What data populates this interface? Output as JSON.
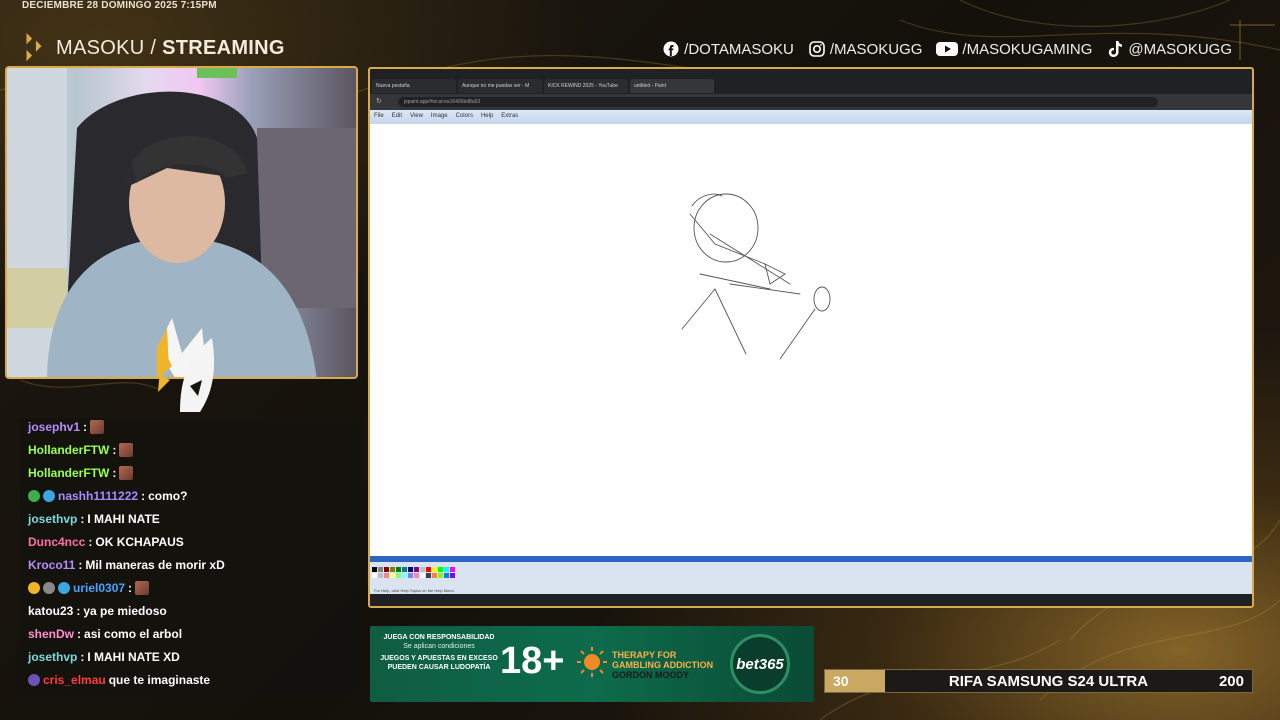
{
  "overlay": {
    "datetime": "DECIEMBRE 28 DOMINGO 2025 7:15PM",
    "brand_name": "MASOKU",
    "brand_separator": " / ",
    "brand_tag": "STREAMING",
    "accent_color": "#d8aa4a"
  },
  "socials": [
    {
      "icon": "facebook-icon",
      "label": "/DOTAMASOKU"
    },
    {
      "icon": "instagram-icon",
      "label": "/MASOKUGG"
    },
    {
      "icon": "youtube-icon",
      "label": "/MASOKUGAMING"
    },
    {
      "icon": "tiktok-icon",
      "label": "@MASOKUGG"
    }
  ],
  "browser": {
    "tabs": [
      {
        "label": "Nueva pestaña"
      },
      {
        "label": "Aunque no me puedas ver - M"
      },
      {
        "label": "KICK REWIND 2025 - YouTube"
      },
      {
        "label": "untitled - Paint"
      }
    ],
    "url": "jspaint.app/#local:ea16406bd8a53",
    "paint_menu": [
      "File",
      "Edit",
      "View",
      "Image",
      "Colors",
      "Help",
      "Extras"
    ],
    "status_text": "For Help, click Help Topics on the Help Menu."
  },
  "chat": [
    {
      "user": "josephv1",
      "user_color": "#b98cff",
      "text": "",
      "emote": true,
      "badges": []
    },
    {
      "user": "HollanderFTW",
      "user_color": "#9bff4d",
      "text": "",
      "emote": true,
      "badges": []
    },
    {
      "user": "HollanderFTW",
      "user_color": "#9bff4d",
      "text": "",
      "emote": true,
      "badges": []
    },
    {
      "user": "nashh1111222",
      "user_color": "#a88bff",
      "text": "como?",
      "emote": false,
      "badges": [
        "#3fae49",
        "#3aa7e0"
      ]
    },
    {
      "user": "josethvp",
      "user_color": "#7fd8d8",
      "text": "I MAHI NATE",
      "emote": false,
      "badges": []
    },
    {
      "user": "Dunc4ncc",
      "user_color": "#ff6fa8",
      "text": "OK KCHAPAUS",
      "emote": false,
      "badges": []
    },
    {
      "user": "Kroco11",
      "user_color": "#b98cff",
      "text": "Mil maneras de morir xD",
      "emote": false,
      "badges": []
    },
    {
      "user": "uriel0307",
      "user_color": "#4aa3ff",
      "text": "",
      "emote": true,
      "badges": [
        "#f0b429",
        "#888888",
        "#3aa7e0"
      ]
    },
    {
      "user": "katou23",
      "user_color": "#ffffff",
      "text": "ya pe miedoso",
      "emote": false,
      "badges": []
    },
    {
      "user": "shenDw",
      "user_color": "#ff8fd0",
      "text": "asi como el arbol",
      "emote": false,
      "badges": []
    },
    {
      "user": "josethvp",
      "user_color": "#7fd8d8",
      "text": "I MAHI NATE XD",
      "emote": false,
      "badges": []
    },
    {
      "user": "cris_elmau",
      "user_color": "#ff3b3b",
      "text": "que te imaginaste",
      "emote": false,
      "badges": [
        "#6d52b8"
      ]
    }
  ],
  "banner": {
    "warning_title": "JUEGA CON RESPONSABILIDAD",
    "warning_sub": "Se aplican condiciones",
    "warning_body": "JUEGOS Y APUESTAS EN EXCESO PUEDEN CAUSAR LUDOPATÍA",
    "age": "18+",
    "therapy_line1": "THERAPY FOR",
    "therapy_line2": "GAMBLING ADDICTION",
    "therapy_org": "GORDON MOODY",
    "sponsor": "bet365"
  },
  "raffle": {
    "current": "30",
    "name": "RIFA SAMSUNG S24 ULTRA",
    "goal": "200",
    "progress": 0.15
  }
}
